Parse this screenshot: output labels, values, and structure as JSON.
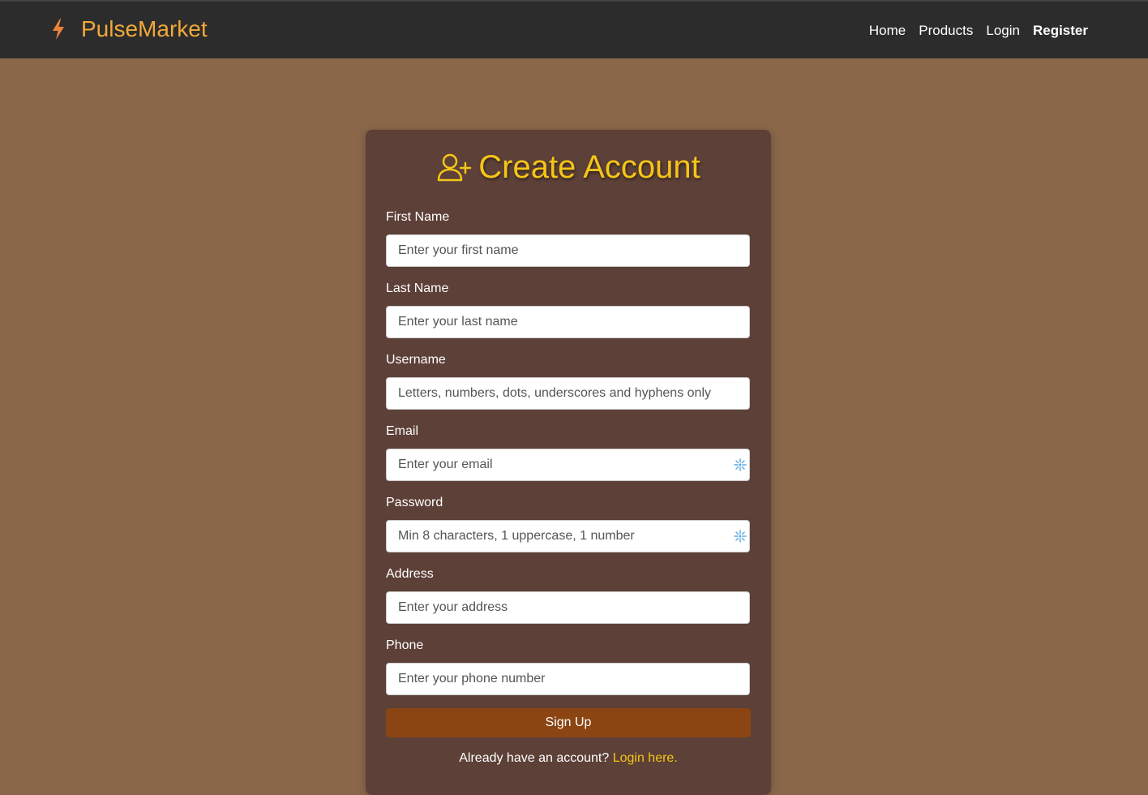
{
  "brand": {
    "name": "PulseMarket",
    "icon": "lightning-bolt-icon",
    "icon_color": "#f0823a",
    "name_color": "#f0a93a"
  },
  "nav": {
    "items": [
      {
        "label": "Home"
      },
      {
        "label": "Products"
      },
      {
        "label": "Login"
      },
      {
        "label": "Register",
        "active": true
      }
    ]
  },
  "form": {
    "title": "Create Account",
    "title_icon": "user-plus-icon",
    "title_color": "#f5c518",
    "fields": [
      {
        "label": "First Name",
        "placeholder": "Enter your first name",
        "value": ""
      },
      {
        "label": "Last Name",
        "placeholder": "Enter your last name",
        "value": ""
      },
      {
        "label": "Username",
        "placeholder": "Letters, numbers, dots, underscores and hyphens only",
        "value": ""
      },
      {
        "label": "Email",
        "placeholder": "Enter your email",
        "value": "",
        "extension_icon": "sparkle-icon"
      },
      {
        "label": "Password",
        "placeholder": "Min 8 characters, 1 uppercase, 1 number",
        "value": "",
        "extension_icon": "sparkle-icon"
      },
      {
        "label": "Address",
        "placeholder": "Enter your address",
        "value": ""
      },
      {
        "label": "Phone",
        "placeholder": "Enter your phone number",
        "value": ""
      }
    ],
    "submit_label": "Sign Up",
    "submit_color": "#8b4513",
    "footer_text": "Already have an account?",
    "footer_link": "Login here."
  },
  "colors": {
    "page_background": "#8a6749",
    "topbar": "#2c2c2c",
    "card": "#5d4037"
  }
}
